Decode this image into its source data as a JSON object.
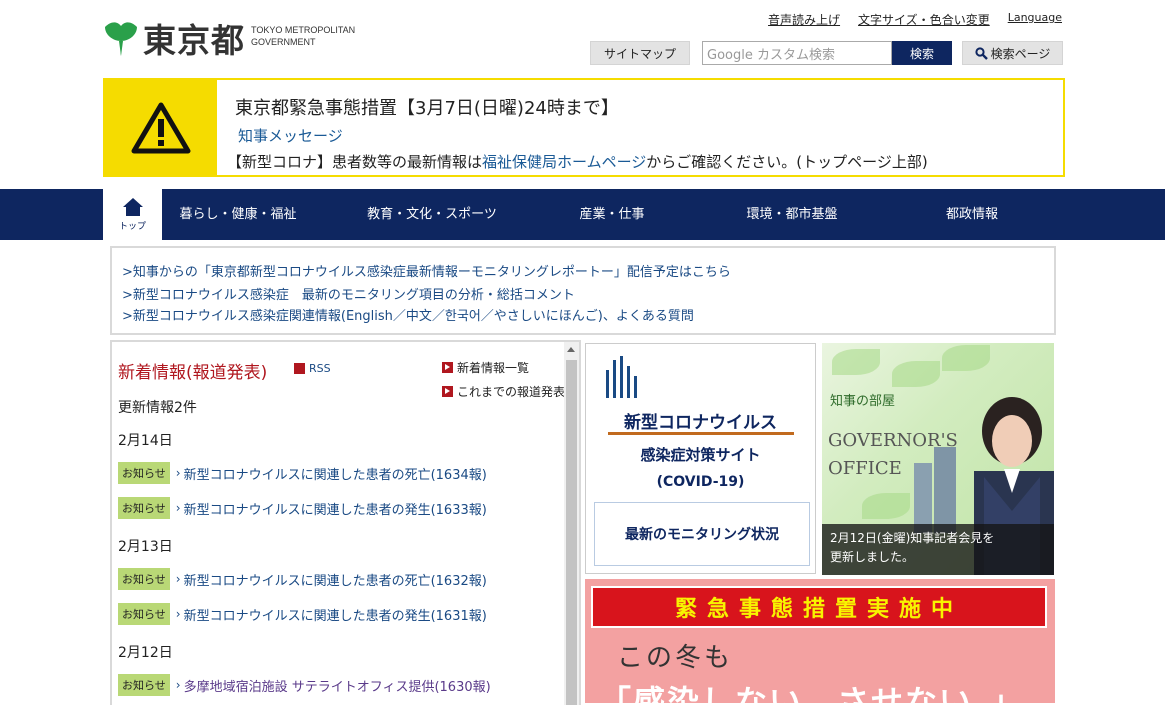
{
  "header": {
    "logo_text": "東京都",
    "logo_en_line1": "TOKYO METROPOLITAN",
    "logo_en_line2": "GOVERNMENT",
    "links": [
      "音声読み上げ",
      "文字サイズ・色合い変更",
      "Language"
    ],
    "sitemap_label": "サイトマップ",
    "search_placeholder": "Google カスタム検索",
    "search_button": "検索",
    "search_page_label": "検索ページ"
  },
  "alert": {
    "title": "東京都緊急事態措置【3月7日(日曜)24時まで】",
    "link": "知事メッセージ",
    "text_pre": "【新型コロナ】患者数等の最新情報は",
    "text_link": "福祉保健局ホームページ",
    "text_post": "からご確認ください。(トップページ上部)"
  },
  "nav": {
    "home_label": "トップ",
    "items": [
      "暮らし・健康・福祉",
      "教育・文化・スポーツ",
      "産業・仕事",
      "環境・都市基盤",
      "都政情報"
    ]
  },
  "notices": [
    ">知事からの「東京都新型コロナウイルス感染症最新情報ーモニタリングレポートー」配信予定はこちら",
    ">新型コロナウイルス感染症　最新のモニタリング項目の分析・総括コメント",
    ">新型コロナウイルス感染症関連情報(English／中文／한국어／やさしいにほんご)、よくある質問"
  ],
  "news": {
    "title": "新着情報(報道発表)",
    "rss": "RSS",
    "list_link": "新着情報一覧",
    "archive_link": "これまでの報道発表",
    "count": "更新情報2件",
    "badge": "お知らせ",
    "groups": [
      {
        "date": "2月14日",
        "items": [
          "新型コロナウイルスに関連した患者の死亡(1634報)",
          "新型コロナウイルスに関連した患者の発生(1633報)"
        ]
      },
      {
        "date": "2月13日",
        "items": [
          "新型コロナウイルスに関連した患者の死亡(1632報)",
          "新型コロナウイルスに関連した患者の発生(1631報)"
        ]
      },
      {
        "date": "2月12日",
        "items": [
          "多摩地域宿泊施設 サテライトオフィス提供(1630報)"
        ]
      }
    ]
  },
  "covid": {
    "title1": "新型コロナウイルス",
    "title2": "感染症対策サイト",
    "title3": "(COVID-19)",
    "box": "最新のモニタリング状況",
    "accent": "#c16a1e"
  },
  "governor": {
    "small": "知事の部屋",
    "big1": "GOVERNOR'S",
    "big2": "OFFICE",
    "caption1": "2月12日(金曜)知事記者会見を",
    "caption2": "更新しました。"
  },
  "emergency": {
    "banner": "緊急事態措置実施中",
    "line1": "この冬も",
    "line2": "「感染しない、させない。」"
  },
  "colors": {
    "navy": "#0e2660",
    "alert_yellow": "#f5dc00",
    "news_red": "#b0171f",
    "badge_green": "#b9d876"
  }
}
